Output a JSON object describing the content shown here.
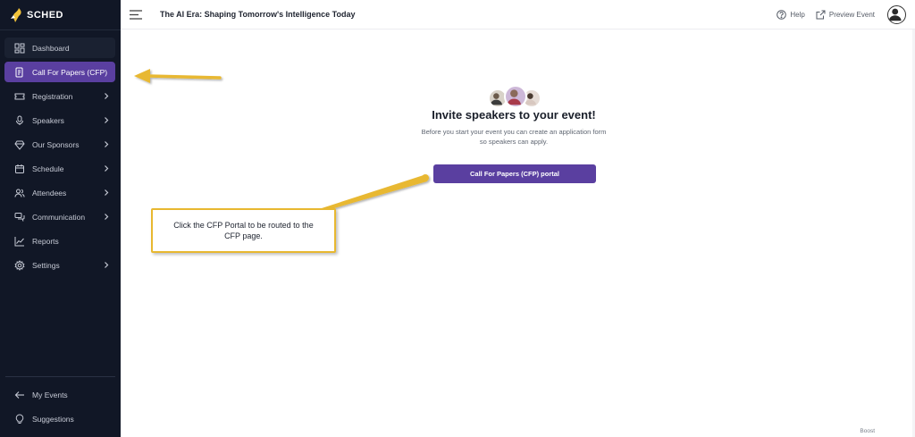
{
  "brand": {
    "name": "SCHED"
  },
  "header": {
    "event_title": "The AI Era: Shaping Tomorrow's Intelligence Today",
    "help_label": "Help",
    "preview_label": "Preview Event"
  },
  "sidebar": {
    "items": [
      {
        "label": "Dashboard",
        "icon": "dashboard-icon",
        "chevron": false
      },
      {
        "label": "Call For Papers (CFP)",
        "icon": "document-icon",
        "chevron": false,
        "active": true
      },
      {
        "label": "Registration",
        "icon": "ticket-icon",
        "chevron": true
      },
      {
        "label": "Speakers",
        "icon": "microphone-icon",
        "chevron": true
      },
      {
        "label": "Our Sponsors",
        "icon": "diamond-icon",
        "chevron": true
      },
      {
        "label": "Schedule",
        "icon": "calendar-icon",
        "chevron": true
      },
      {
        "label": "Attendees",
        "icon": "users-icon",
        "chevron": true
      },
      {
        "label": "Communication",
        "icon": "chat-icon",
        "chevron": true
      },
      {
        "label": "Reports",
        "icon": "chart-icon",
        "chevron": false
      },
      {
        "label": "Settings",
        "icon": "gear-icon",
        "chevron": true
      }
    ],
    "bottom_items": [
      {
        "label": "My Events",
        "icon": "arrow-left-icon"
      },
      {
        "label": "Suggestions",
        "icon": "lightbulb-icon"
      }
    ]
  },
  "main": {
    "title": "Invite speakers to your event!",
    "description": "Before you start your event you can create an application form so speakers can apply.",
    "cfp_button_label": "Call For Papers (CFP) portal",
    "boost_label": "Boost"
  },
  "annotation": {
    "callout_text": "Click the CFP Portal to be routed to the CFP page."
  },
  "colors": {
    "sidebar_bg": "#111726",
    "accent": "#5a3fa0",
    "annotation": "#e8b830"
  }
}
